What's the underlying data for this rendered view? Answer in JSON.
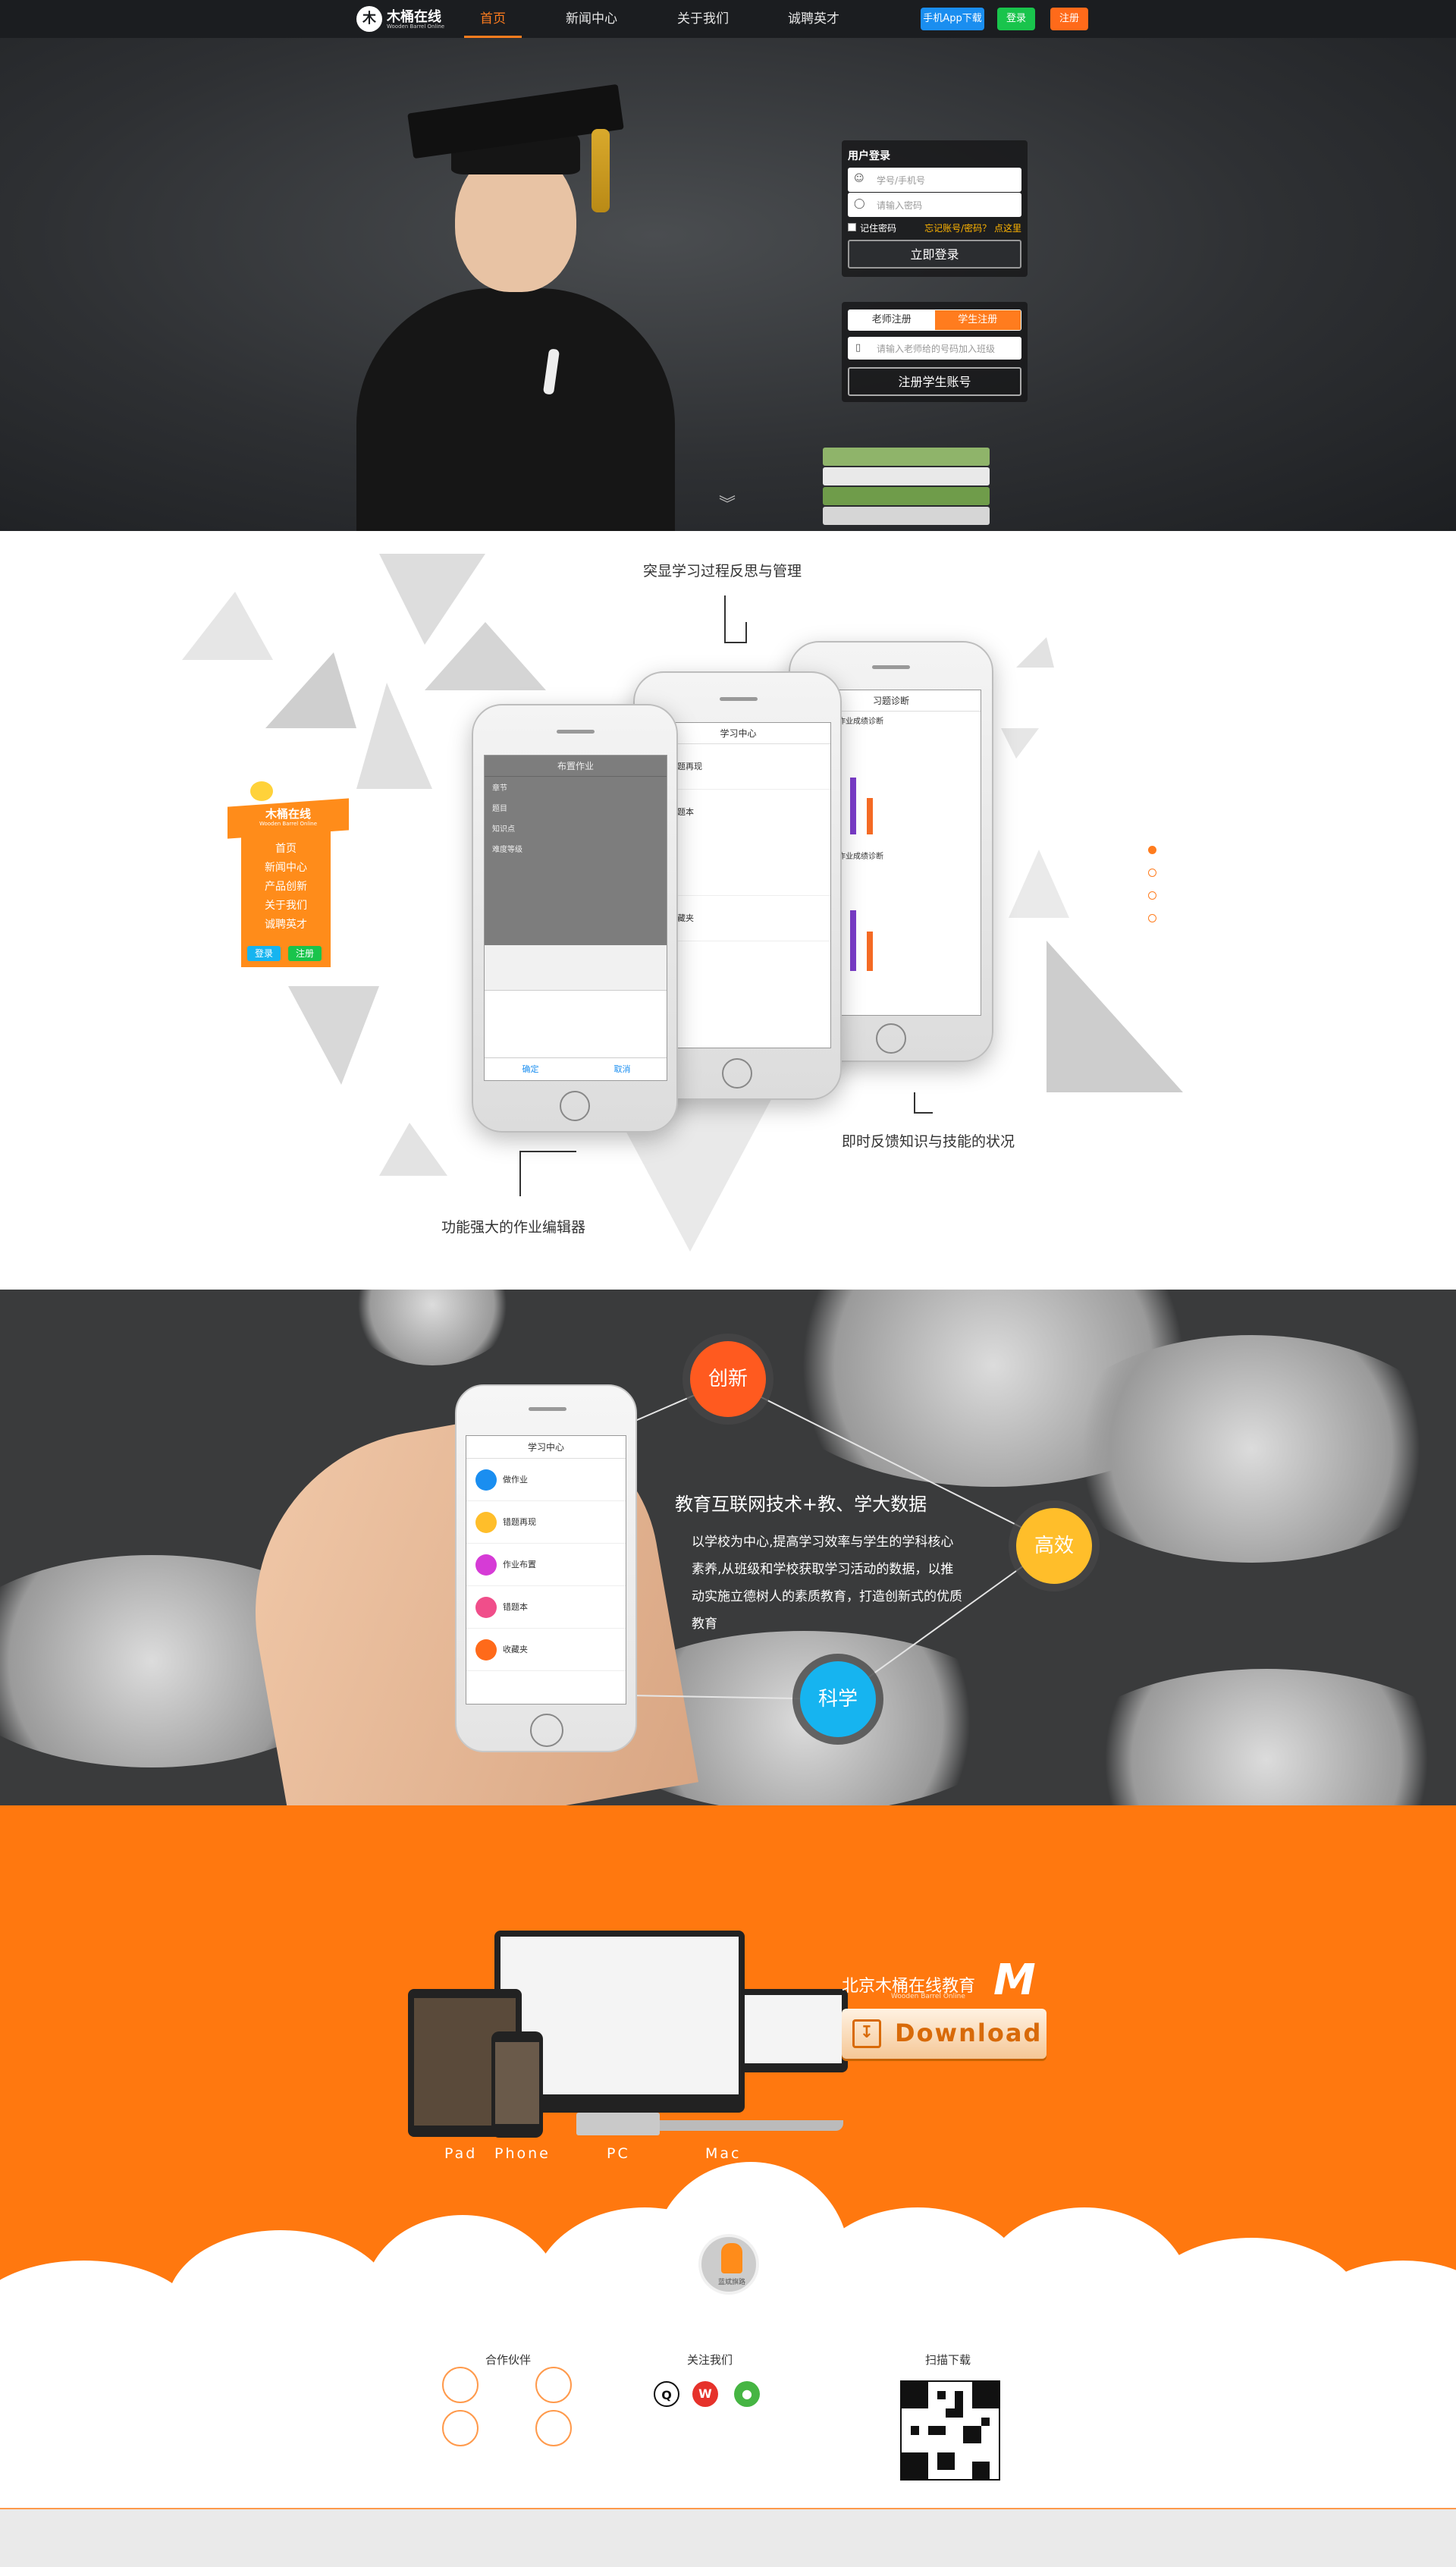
{
  "nav": {
    "logo_text": "木桶在线",
    "logo_sub": "Wooden Barrel Online",
    "items": [
      "首页",
      "新闻中心",
      "关于我们",
      "诚聘英才"
    ],
    "app_download": "手机App下载",
    "login": "登录",
    "register": "注册",
    "colors": {
      "app": "#1a8ef0",
      "login": "#19c44c",
      "register": "#ff6a1a"
    }
  },
  "login": {
    "title": "用户登录",
    "user_placeholder": "学号/手机号",
    "pass_placeholder": "请输入密码",
    "remember": "记住密码",
    "forgot": "忘记账号/密码？ 点这里",
    "submit": "立即登录"
  },
  "register": {
    "tab_teacher": "老师注册",
    "tab_student": "学生注册",
    "code_placeholder": "请输入老师给的号码加入班级",
    "submit": "注册学生账号"
  },
  "features": {
    "caption_top": "突显学习过程反思与管理",
    "caption_right": "即时反馈知识与技能的状况",
    "caption_left": "功能强大的作业编辑器",
    "phone_mid_title": "学习中心",
    "phone_mid_rows": [
      "错题再现",
      "错题本",
      "收藏夹"
    ],
    "phone_right_title": "习题诊断",
    "phone_right_sub1": "初中阅读作业成绩诊断",
    "phone_right_sub2": "高中数学作业成绩诊断",
    "phone_left_title": "布置作业",
    "phone_left_rows": [
      "章节",
      "题目",
      "知识点",
      "难度等级"
    ],
    "phone_left_ok": "确定",
    "phone_left_cancel": "取消",
    "chart_colors": [
      "#b6d92e",
      "#1fb5c9",
      "#7a3cc9",
      "#f46a24"
    ]
  },
  "side_nav": {
    "title": "木桶在线",
    "sub": "Wooden Barrel Online",
    "items": [
      "首页",
      "新闻中心",
      "产品创新",
      "关于我们",
      "诚聘英才"
    ],
    "login": "登录",
    "register": "注册"
  },
  "tech": {
    "phone_title": "学习中心",
    "phone_rows": [
      "做作业",
      "错题再现",
      "作业布置",
      "错题本",
      "收藏夹"
    ],
    "circle_1": "创新",
    "circle_2": "高效",
    "circle_3": "科学",
    "title": "教育互联网技术+教、学大数据",
    "body": "以学校为中心,提高学习效率与学生的学科核心素养,从班级和学校获取学习活动的数据，以推动实施立德树人的素质教育，打造创新式的优质教育",
    "colors": {
      "circle_1": "#ff5a1f",
      "circle_2": "#ffbe2a",
      "circle_3": "#16b4f0"
    }
  },
  "download": {
    "labels": [
      "Pad",
      "Phone",
      "PC",
      "Mac"
    ],
    "brand": "北京木桶在线教育",
    "brand_sub": "Wooden Barrel Online",
    "brand_mark": "M",
    "button": "Download"
  },
  "footer": {
    "avatar_text": "蓝斌旗路",
    "partners": "合作伙伴",
    "follow": "关注我们",
    "scan": "扫描下载",
    "social": [
      "qq-icon",
      "weibo-icon",
      "wechat-icon"
    ]
  }
}
